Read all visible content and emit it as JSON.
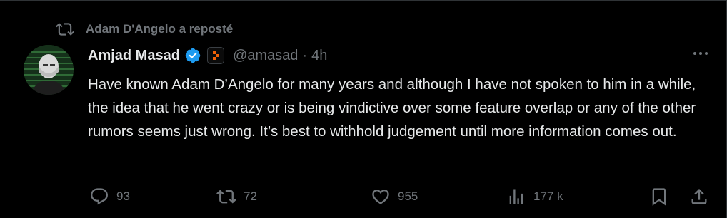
{
  "repost": {
    "label": "Adam D'Angelo a reposté",
    "icon": "repost-icon"
  },
  "author": {
    "name": "Amjad Masad",
    "handle": "@amasad",
    "separator": "·",
    "time": "4h",
    "verified_icon": "verified-badge-icon",
    "affiliation_icon": "replit-logo-icon",
    "verified_color": "#1d9bf0",
    "affiliation_color": "#f26207"
  },
  "tweet": {
    "text": "Have known Adam D’Angelo for many years and although I have not spoken to him in a while, the idea that he went crazy or is being vindictive over some feature overlap or any of the other rumors seems just wrong. It’s best to withhold judgement until more information comes out."
  },
  "actions": {
    "replies": "93",
    "reposts": "72",
    "likes": "955",
    "views": "177 k"
  }
}
